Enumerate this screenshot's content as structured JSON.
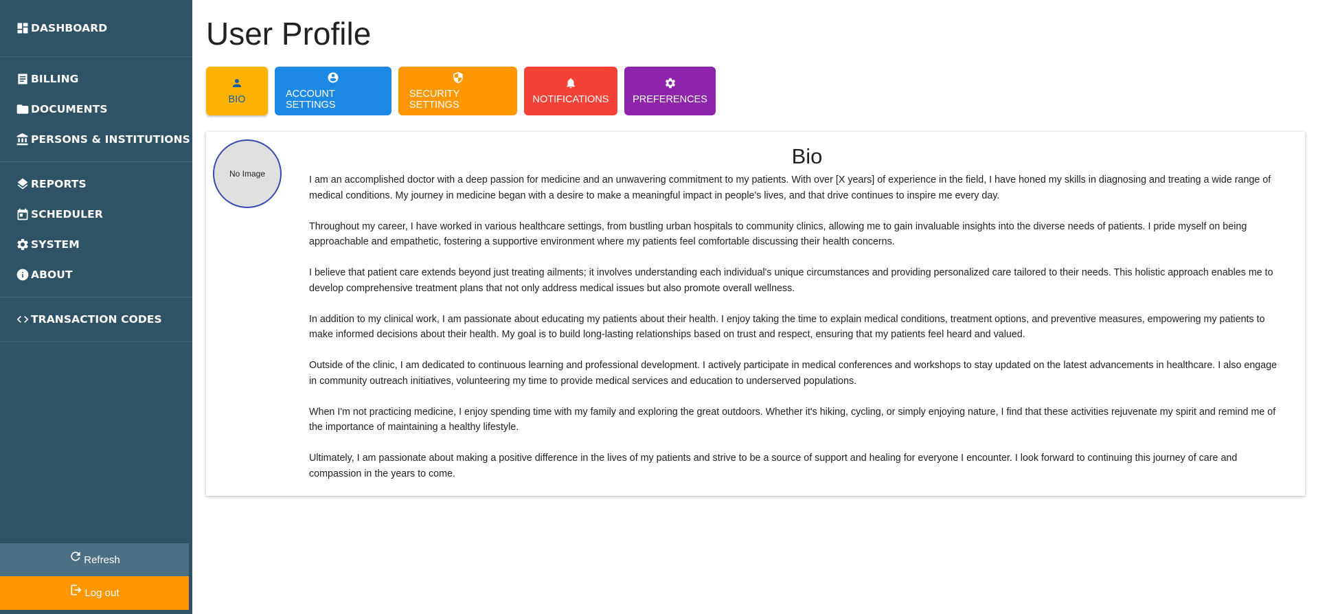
{
  "sidebar": {
    "groups": [
      [
        {
          "label": "DASHBOARD",
          "icon": "dashboard-icon"
        }
      ],
      [
        {
          "label": "BILLING",
          "icon": "receipt-icon"
        },
        {
          "label": "DOCUMENTS",
          "icon": "folder-icon"
        },
        {
          "label": "PERSONS & INSTITUTIONS",
          "icon": "institution-icon"
        }
      ],
      [
        {
          "label": "REPORTS",
          "icon": "layers-icon"
        },
        {
          "label": "SCHEDULER",
          "icon": "calendar-icon"
        },
        {
          "label": "SYSTEM",
          "icon": "gear-icon"
        },
        {
          "label": "ABOUT",
          "icon": "info-icon"
        }
      ],
      [
        {
          "label": "TRANSACTION CODES",
          "icon": "code-icon"
        }
      ]
    ],
    "refresh_label": "Refresh",
    "logout_label": "Log out"
  },
  "page": {
    "title": "User Profile"
  },
  "tabs": [
    {
      "label": "BIO",
      "icon": "person-icon",
      "color": "#ffb300",
      "active": true
    },
    {
      "label": "ACCOUNT SETTINGS",
      "icon": "account-circle-icon",
      "color": "#1e88e5"
    },
    {
      "label": "SECURITY SETTINGS",
      "icon": "shield-icon",
      "color": "#ff9800"
    },
    {
      "label": "NOTIFICATIONS",
      "icon": "bell-icon",
      "color": "#f44336"
    },
    {
      "label": "PREFERENCES",
      "icon": "gear-icon",
      "color": "#8e24aa"
    }
  ],
  "bio": {
    "avatar_text": "No Image",
    "title": "Bio",
    "paragraphs": [
      "I am an accomplished doctor with a deep passion for medicine and an unwavering commitment to my patients. With over [X years] of experience in the field, I have honed my skills in diagnosing and treating a wide range of medical conditions. My journey in medicine began with a desire to make a meaningful impact in people's lives, and that drive continues to inspire me every day.",
      "Throughout my career, I have worked in various healthcare settings, from bustling urban hospitals to community clinics, allowing me to gain invaluable insights into the diverse needs of patients. I pride myself on being approachable and empathetic, fostering a supportive environment where my patients feel comfortable discussing their health concerns.",
      "I believe that patient care extends beyond just treating ailments; it involves understanding each individual's unique circumstances and providing personalized care tailored to their needs. This holistic approach enables me to develop comprehensive treatment plans that not only address medical issues but also promote overall wellness.",
      "In addition to my clinical work, I am passionate about educating my patients about their health. I enjoy taking the time to explain medical conditions, treatment options, and preventive measures, empowering my patients to make informed decisions about their health. My goal is to build long-lasting relationships based on trust and respect, ensuring that my patients feel heard and valued.",
      "Outside of the clinic, I am dedicated to continuous learning and professional development. I actively participate in medical conferences and workshops to stay updated on the latest advancements in healthcare. I also engage in community outreach initiatives, volunteering my time to provide medical services and education to underserved populations.",
      "When I'm not practicing medicine, I enjoy spending time with my family and exploring the great outdoors. Whether it's hiking, cycling, or simply enjoying nature, I find that these activities rejuvenate my spirit and remind me of the importance of maintaining a healthy lifestyle.",
      "Ultimately, I am passionate about making a positive difference in the lives of my patients and strive to be a source of support and healing for everyone I encounter. I look forward to continuing this journey of care and compassion in the years to come."
    ]
  }
}
